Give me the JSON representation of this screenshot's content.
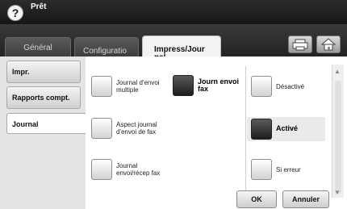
{
  "status": {
    "help_symbol": "?",
    "title": "Prêt"
  },
  "tabs": [
    {
      "label": "Général",
      "active": false
    },
    {
      "label": "Configuratio\nn",
      "active": false
    },
    {
      "label": "Impress/Jour\nnal",
      "active": true
    }
  ],
  "toolbar": {
    "print_icon": "printer-icon",
    "home_icon": "home-icon"
  },
  "sidebar": {
    "items": [
      {
        "label": "Impr.",
        "selected": false
      },
      {
        "label": "Rapports compt.",
        "selected": false
      },
      {
        "label": "Journal",
        "selected": true
      }
    ]
  },
  "options": {
    "journal_multiple": {
      "label": "Journal d'envoi multiple",
      "checked": false
    },
    "journ_envoi_fax": {
      "label": "Journ envoi fax",
      "checked": true
    },
    "aspect_journal": {
      "label": "Aspect journal d'envoi de fax",
      "checked": false
    },
    "journal_recep": {
      "label": "Journal envoi/récep fax",
      "checked": false
    }
  },
  "modes": {
    "desactive": {
      "label": "Désactivé",
      "checked": false
    },
    "active": {
      "label": "Activé",
      "checked": true
    },
    "si_erreur": {
      "label": "Si erreur",
      "checked": false
    }
  },
  "buttons": {
    "ok": "OK",
    "cancel": "Annuler"
  },
  "colors": {
    "topbar": "#1e1e1e",
    "checked": "#2a2a2a",
    "panel": "#e4e4e4"
  }
}
